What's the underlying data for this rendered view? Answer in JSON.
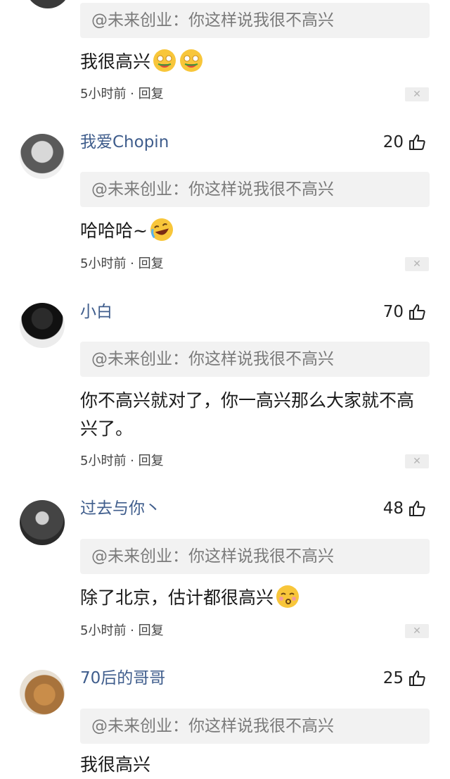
{
  "comments": [
    {
      "username": "",
      "likes": "",
      "quote": "@未来创业：你这样说我很不高兴",
      "text": "我很高兴",
      "emojis": [
        "watermelon-face-icon",
        "watermelon-face-icon"
      ],
      "time": "5小时前",
      "reply": "回复",
      "close": "✕"
    },
    {
      "username": "我爱Chopin",
      "likes": "20",
      "quote": "@未来创业：你这样说我很不高兴",
      "text": "哈哈哈~",
      "emojis": [
        "laugh-cry-icon"
      ],
      "time": "5小时前",
      "reply": "回复",
      "close": "✕"
    },
    {
      "username": "小白",
      "likes": "70",
      "quote": "@未来创业：你这样说我很不高兴",
      "text": "你不高兴就对了，你一高兴那么大家就不高兴了。",
      "emojis": [],
      "time": "5小时前",
      "reply": "回复",
      "close": "✕"
    },
    {
      "username": "过去与你丶",
      "likes": "48",
      "quote": "@未来创业：你这样说我很不高兴",
      "text": "除了北京，估计都很高兴",
      "emojis": [
        "kiss-face-icon"
      ],
      "time": "5小时前",
      "reply": "回复",
      "close": "✕"
    },
    {
      "username": "70后的哥哥",
      "likes": "25",
      "quote": "@未来创业：你这样说我很不高兴",
      "text": "我很高兴",
      "emojis": [],
      "time": "",
      "reply": "",
      "close": ""
    }
  ],
  "colors": {
    "username": "#3f5d8c",
    "quote_bg": "#f2f2f2",
    "quote_text": "#7a7a7a"
  }
}
